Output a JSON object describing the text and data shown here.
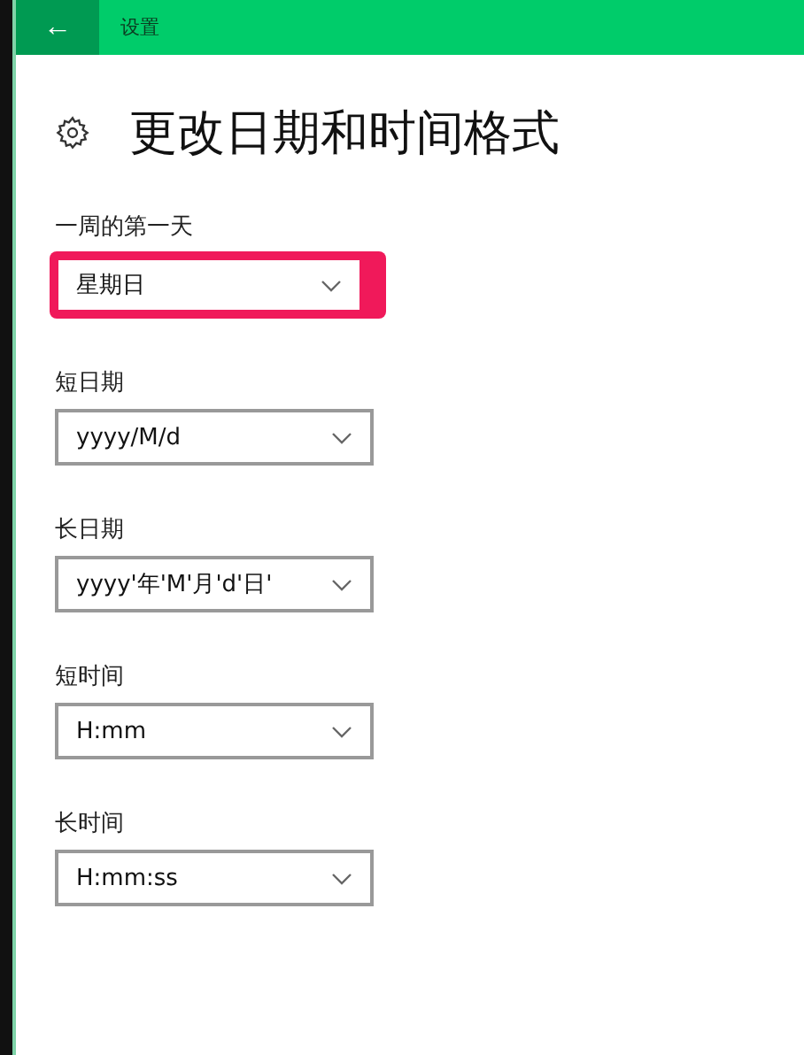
{
  "header": {
    "back_icon": "←",
    "title": "设置"
  },
  "page": {
    "title": "更改日期和时间格式"
  },
  "settings": [
    {
      "label": "一周的第一天",
      "value": "星期日",
      "highlighted": true
    },
    {
      "label": "短日期",
      "value": "yyyy/M/d",
      "highlighted": false
    },
    {
      "label": "长日期",
      "value": "yyyy'年'M'月'd'日'",
      "highlighted": false
    },
    {
      "label": "短时间",
      "value": "H:mm",
      "highlighted": false
    },
    {
      "label": "长时间",
      "value": "H:mm:ss",
      "highlighted": false
    }
  ]
}
